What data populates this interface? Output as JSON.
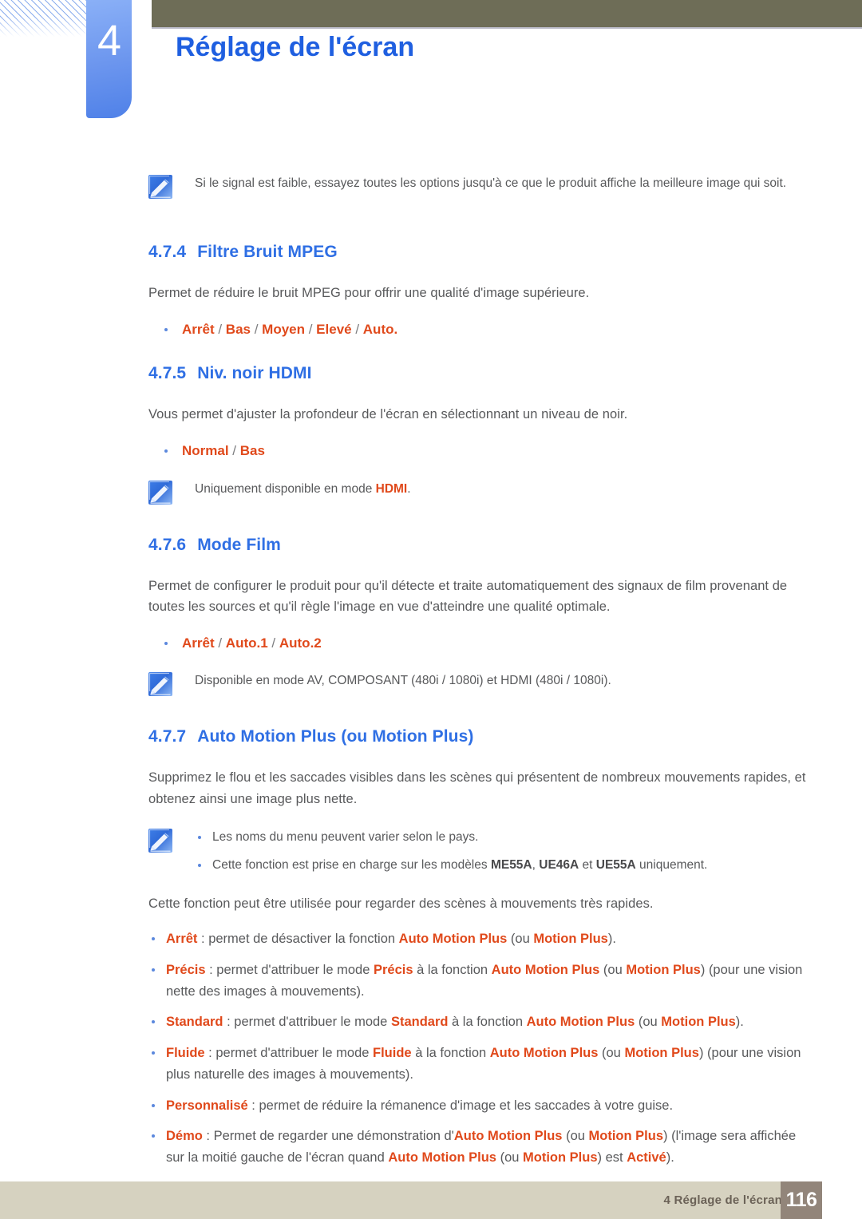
{
  "chapter": {
    "number": "4",
    "title": "Réglage de l'écran"
  },
  "notes": {
    "signal_weak": "Si le signal est faible, essayez toutes les options jusqu'à ce que le produit affiche la meilleure image qui soit.",
    "hdmi_only_prefix": "Uniquement disponible en mode ",
    "hdmi_only_kw": "HDMI",
    "hdmi_only_suffix": ".",
    "film_modes": "Disponible en mode AV, COMPOSANT (480i / 1080i) et HDMI (480i / 1080i).",
    "menu_names_vary": "Les noms du menu peuvent varier selon le pays.",
    "models_prefix": "Cette fonction est prise en charge sur les modèles ",
    "models_1": "ME55A",
    "models_sep1": ", ",
    "models_2": "UE46A",
    "models_sep2": " et ",
    "models_3": "UE55A",
    "models_suffix": " uniquement."
  },
  "sections": [
    {
      "num": "4.7.4",
      "title": "Filtre Bruit MPEG",
      "body": "Permet de réduire le bruit MPEG pour offrir une qualité d'image supérieure.",
      "options": [
        "Arrêt",
        "Bas",
        "Moyen",
        "Elevé",
        "Auto."
      ]
    },
    {
      "num": "4.7.5",
      "title": "Niv. noir HDMI",
      "body": "Vous permet d'ajuster la profondeur de l'écran en sélectionnant un niveau de noir.",
      "options": [
        "Normal",
        "Bas"
      ]
    },
    {
      "num": "4.7.6",
      "title": "Mode Film",
      "body": "Permet de configurer le produit pour qu'il détecte et traite automatiquement des signaux de film provenant de toutes les sources et qu'il règle l'image en vue d'atteindre une qualité optimale.",
      "options": [
        "Arrêt",
        "Auto.1",
        "Auto.2"
      ]
    },
    {
      "num": "4.7.7",
      "title": "Auto Motion Plus (ou Motion Plus)",
      "body": "Supprimez le flou et les saccades visibles dans les scènes qui présentent de nombreux mouvements rapides, et obtenez ainsi une image plus nette.",
      "body2": "Cette fonction peut être utilisée pour regarder des scènes à mouvements très rapides."
    }
  ],
  "mode_list": [
    {
      "kw": "Arrêt",
      "t1": " : permet de désactiver la fonction ",
      "kw2": "Auto Motion Plus",
      "t2": " (ou ",
      "kw3": "Motion Plus",
      "t3": ")."
    },
    {
      "kw": "Précis",
      "t1": " : permet d'attribuer le mode ",
      "kw1b": "Précis",
      "t1b": " à la fonction ",
      "kw2": "Auto Motion Plus",
      "t2": " (ou ",
      "kw3": "Motion Plus",
      "t3": ") (pour une vision nette des images à mouvements)."
    },
    {
      "kw": "Standard",
      "t1": " : permet d'attribuer le mode ",
      "kw1b": "Standard",
      "t1b": " à la fonction ",
      "kw2": "Auto Motion Plus",
      "t2": " (ou ",
      "kw3": "Motion Plus",
      "t3": ")."
    },
    {
      "kw": "Fluide",
      "t1": " : permet d'attribuer le mode ",
      "kw1b": "Fluide",
      "t1b": " à la fonction ",
      "kw2": "Auto Motion Plus",
      "t2": " (ou ",
      "kw3": "Motion Plus",
      "t3": ") (pour une vision plus naturelle des images à mouvements)."
    },
    {
      "kw": "Personnalisé",
      "t1": " : permet de réduire la rémanence d'image et les saccades à votre guise."
    },
    {
      "kw": "Démo",
      "t1": " : Permet de regarder une démonstration d'",
      "kw2": "Auto Motion Plus",
      "t2": " (ou ",
      "kw3": "Motion Plus",
      "t3": ") (l'image sera affichée sur la moitié gauche de l'écran quand ",
      "kw4": "Auto Motion Plus",
      "t4": " (ou ",
      "kw5": "Motion Plus",
      "t5": ") est ",
      "kw6": "Activé",
      "t6": ")."
    }
  ],
  "footer": {
    "label": "4 Réglage de l'écran",
    "page": "116"
  },
  "colors": {
    "accent_blue": "#2f6fe4",
    "option_orange": "#e0491b",
    "body_gray": "#58595b",
    "header_olive": "#6e6d57",
    "footer_beige": "#d6d2c0",
    "footer_page_brown": "#92857a"
  }
}
